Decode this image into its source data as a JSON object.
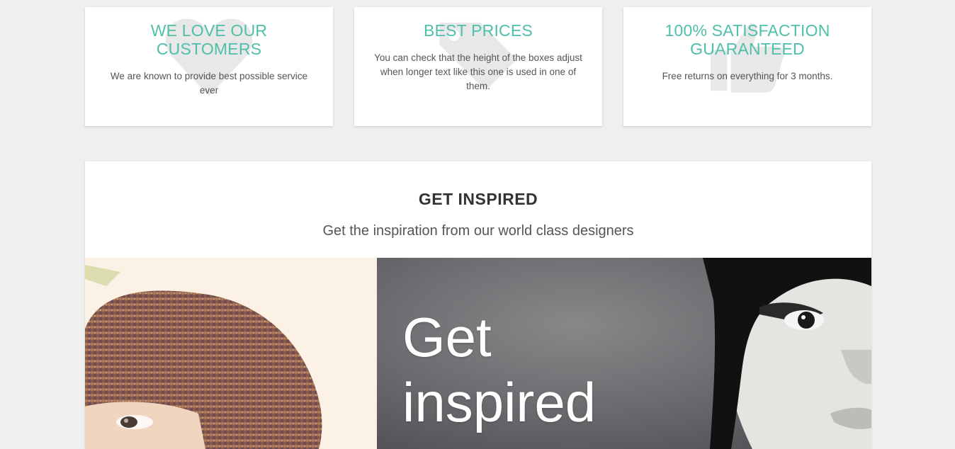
{
  "features": [
    {
      "title": "WE LOVE OUR CUSTOMERS",
      "text": "We are known to provide best possible service ever",
      "icon": "heart-icon"
    },
    {
      "title": "BEST PRICES",
      "text": "You can check that the height of the boxes adjust when longer text like this one is used in one of them.",
      "icon": "price-tag-icon"
    },
    {
      "title": "100% SATISFACTION GUARANTEED",
      "text": "Free returns on everything for 3 months.",
      "icon": "thumbs-up-icon"
    }
  ],
  "inspire": {
    "title": "GET INSPIRED",
    "lead": "Get the inspiration from our world class designers",
    "banner_heading": "Get inspired"
  },
  "colors": {
    "accent": "#4fbfa8",
    "background": "#efefef"
  }
}
